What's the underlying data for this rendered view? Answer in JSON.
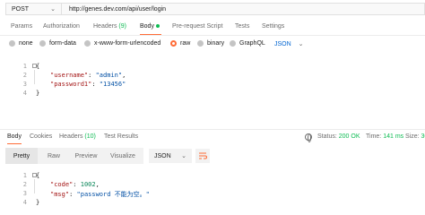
{
  "request": {
    "method": "POST",
    "url": "http://genes.dev.com/api/user/login"
  },
  "request_tabs": [
    {
      "label": "Params"
    },
    {
      "label": "Authorization"
    },
    {
      "label": "Headers",
      "count": "(9)"
    },
    {
      "label": "Body",
      "active": true
    },
    {
      "label": "Pre-request Script"
    },
    {
      "label": "Tests"
    },
    {
      "label": "Settings"
    }
  ],
  "body_types": [
    "none",
    "form-data",
    "x-www-form-urlencoded",
    "raw",
    "binary",
    "GraphQL"
  ],
  "body_type_selected": "raw",
  "raw_format": "JSON",
  "request_body_lines": [
    {
      "n": "1",
      "text": "{"
    },
    {
      "n": "2",
      "key": "\"username\"",
      "sep": ": ",
      "val": "\"admin\"",
      "end": ","
    },
    {
      "n": "3",
      "key": "\"password1\"",
      "sep": ": ",
      "val": "\"13456\"",
      "end": ""
    },
    {
      "n": "4",
      "text": "}"
    }
  ],
  "response_tabs": [
    {
      "label": "Body",
      "active": true
    },
    {
      "label": "Cookies"
    },
    {
      "label": "Headers",
      "count": "(10)"
    },
    {
      "label": "Test Results"
    }
  ],
  "response_meta": {
    "status_label": "Status:",
    "status_value": "200 OK",
    "time_label": "Time:",
    "time_value": "141 ms",
    "size_label": "Size:",
    "size_value": "36"
  },
  "response_views": [
    "Pretty",
    "Raw",
    "Preview",
    "Visualize"
  ],
  "response_format": "JSON",
  "response_body_lines": [
    {
      "n": "1",
      "text": "{"
    },
    {
      "n": "2",
      "key": "\"code\"",
      "sep": ": ",
      "num": "1002",
      "end": ","
    },
    {
      "n": "3",
      "key": "\"msg\"",
      "sep": ": ",
      "val": "\"password 不能为空。\"",
      "end": ""
    },
    {
      "n": "4",
      "text": "}"
    }
  ],
  "colors": {
    "accent": "#ff6c37",
    "success": "#0cbb52",
    "link": "#0265d2"
  }
}
